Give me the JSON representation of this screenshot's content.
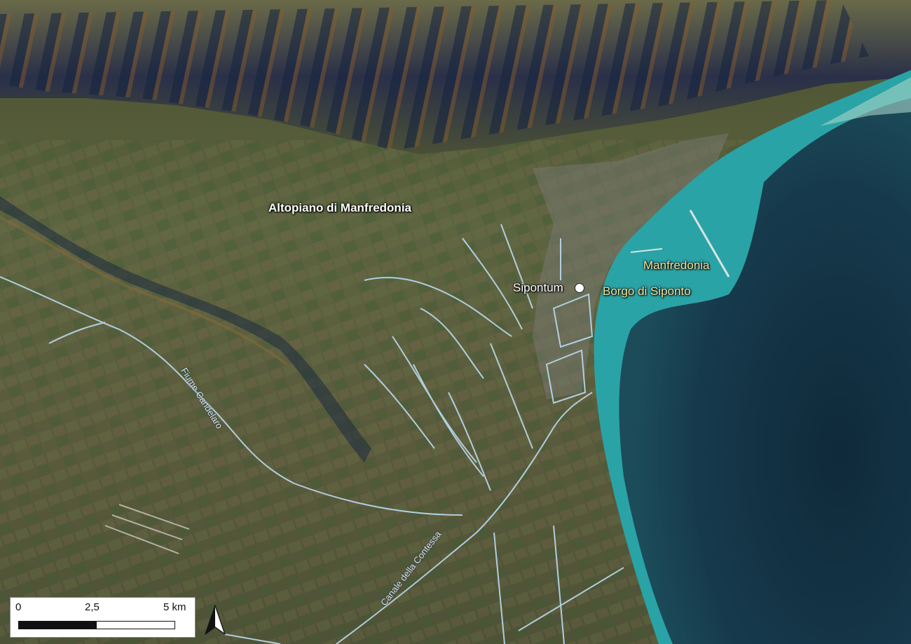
{
  "map": {
    "labels": {
      "plateau": "Altopiano di Manfredonia",
      "site": "Sipontum",
      "town": "Manfredonia",
      "borgo": "Borgo di Siponto",
      "river1": "Fiume Candelaro",
      "river2": "Canale della Contessa"
    },
    "scalebar": {
      "tick0": "0",
      "tick1": "2,5",
      "tick2": "5 km"
    },
    "north_arrow": "north-arrow",
    "colors": {
      "sea_deep": "#12303f",
      "sea_shallow": "#2aa3a6",
      "land": "#5a6040",
      "mountain_shadow": "#1a2a4a",
      "water_lines": "#b9dcef",
      "label_yellow": "#f3e7a0"
    }
  }
}
